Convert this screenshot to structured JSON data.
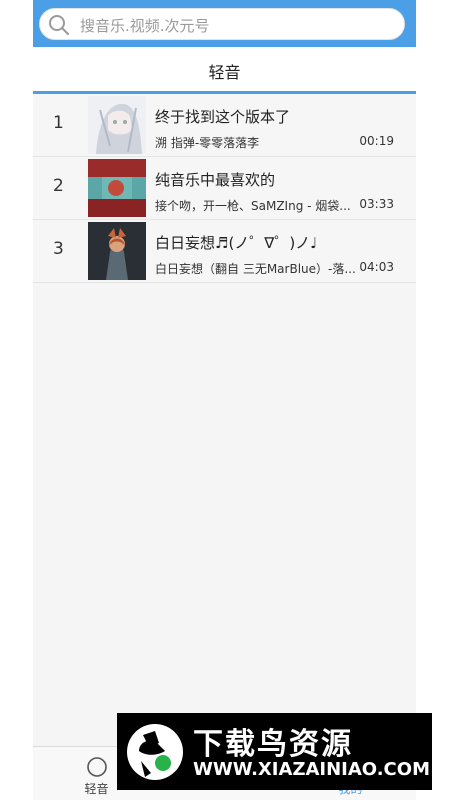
{
  "search": {
    "placeholder": "搜音乐.视频.次元号"
  },
  "header": {
    "title": "轻音"
  },
  "songs": [
    {
      "rank": "1",
      "title": "终于找到这个版本了",
      "subtitle": "溯 指弹-零零落落李",
      "duration": "00:19"
    },
    {
      "rank": "2",
      "title": "纯音乐中最喜欢的",
      "subtitle": "接个吻，开一枪、SaMZIng - 烟袋...",
      "duration": "03:33"
    },
    {
      "rank": "3",
      "title": "白日妄想♬(ノ゜∇゜)ノ♩",
      "subtitle": "白日妄想（翻自 三无MarBlue）-落...",
      "duration": "04:03"
    }
  ],
  "tabs": [
    {
      "label": "轻音",
      "active": false
    },
    {
      "label": "",
      "active": false
    },
    {
      "label": "我的",
      "active": true
    }
  ],
  "watermark": {
    "brand": "下载鸟资源",
    "url": "WWW.XIAZAINIAO.COM"
  },
  "colors": {
    "accent": "#4a9fe6"
  }
}
